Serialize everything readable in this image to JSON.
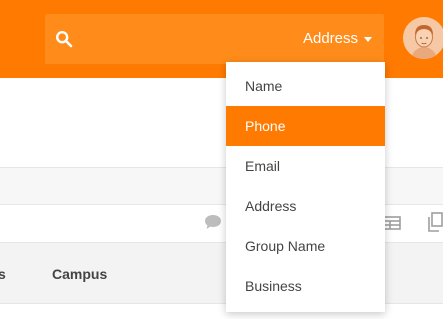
{
  "header": {
    "search": {
      "placeholder": "",
      "value": "",
      "scope_label": "Address"
    }
  },
  "dropdown": {
    "items": [
      {
        "label": "Name"
      },
      {
        "label": "Phone"
      },
      {
        "label": "Email"
      },
      {
        "label": "Address"
      },
      {
        "label": "Group Name"
      },
      {
        "label": "Business"
      }
    ],
    "highlighted_index": 1
  },
  "table": {
    "columns": [
      "s",
      "Campus"
    ]
  },
  "colors": {
    "brand": "#ff7a00",
    "search_bg": "#ff8c1a",
    "highlight": "#ff7a00"
  },
  "icons": {
    "search": "search-icon",
    "avatar": "avatar",
    "chat": "chat-icon",
    "grid": "grid-view-icon",
    "copy": "copy-icon"
  }
}
